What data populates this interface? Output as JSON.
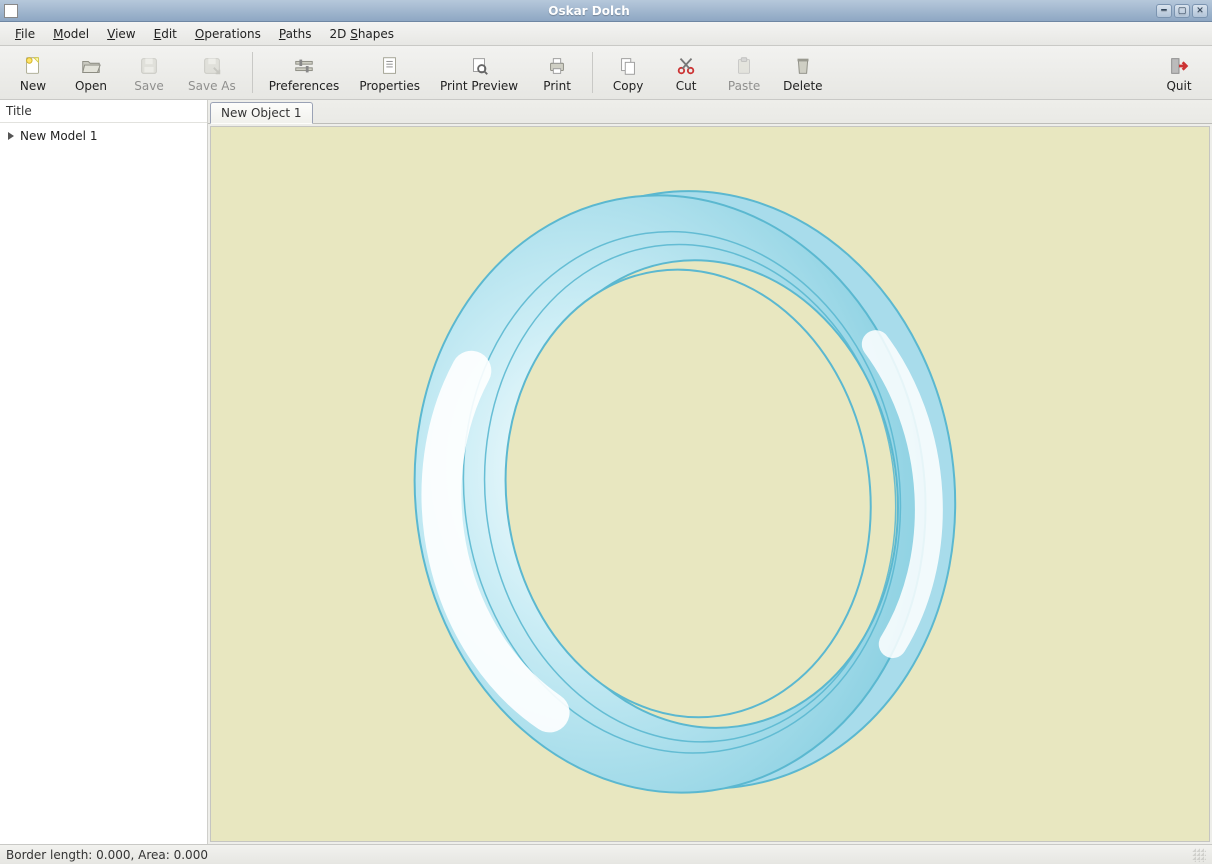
{
  "window": {
    "title": "Oskar Dolch"
  },
  "menus": {
    "file": "File",
    "model": "Model",
    "view": "View",
    "edit": "Edit",
    "operations": "Operations",
    "paths": "Paths",
    "shapes2d": "2D Shapes"
  },
  "toolbar": {
    "new": "New",
    "open": "Open",
    "save": "Save",
    "save_as": "Save As",
    "preferences": "Preferences",
    "properties": "Properties",
    "print_preview": "Print Preview",
    "print": "Print",
    "copy": "Copy",
    "cut": "Cut",
    "paste": "Paste",
    "delete": "Delete",
    "quit": "Quit"
  },
  "sidebar": {
    "header": "Title",
    "tree": {
      "items": [
        {
          "label": "New Model 1"
        }
      ]
    }
  },
  "tabs": [
    {
      "label": "New Object 1"
    }
  ],
  "status": {
    "text": "Border length: 0.000, Area: 0.000"
  },
  "colors": {
    "canvas_bg": "#e8e7c0",
    "ring_fill": "#a8dceb",
    "ring_stroke": "#5bb8d0"
  }
}
